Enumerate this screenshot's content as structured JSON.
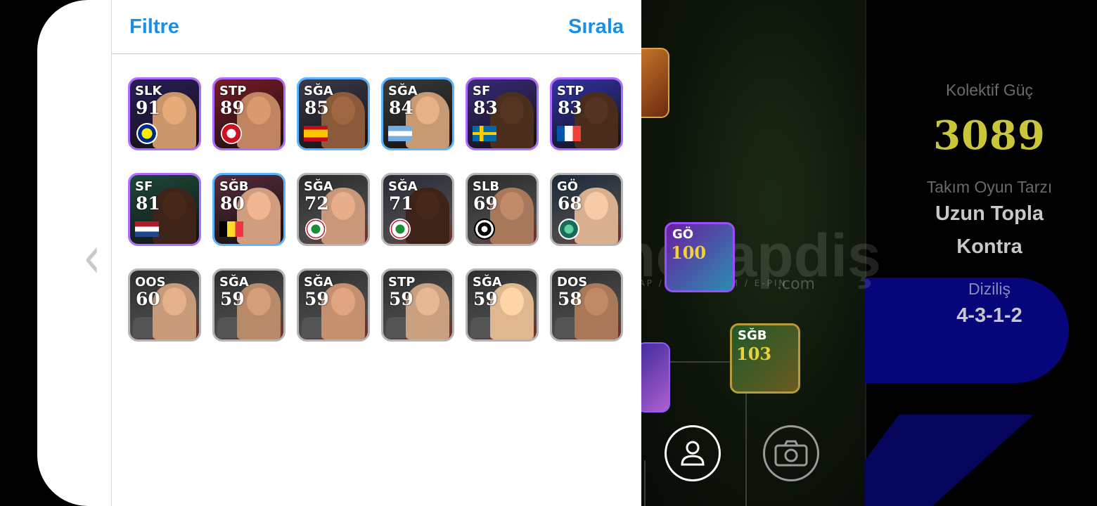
{
  "header": {
    "filter_label": "Filtre",
    "sort_label": "Sıralа"
  },
  "stats": {
    "collective_power_label": "Kolektif Güç",
    "collective_power_value": "3089",
    "playstyle_label": "Takım Oyun Tarzı",
    "playstyle_value_line1": "Uzun Topla",
    "playstyle_value_line2": "Kontra",
    "formation_label": "Diziliş",
    "formation_value": "4-3-1-2"
  },
  "field_cards": {
    "mid": {
      "pos": "GÖ",
      "ovr": "100"
    },
    "sgb": {
      "pos": "SĞB",
      "ovr": "103"
    }
  },
  "watermark": {
    "main": "hesapdiş",
    "sub": "HESAP / SKIN / ITEM / E-PIN",
    "com": ".com"
  },
  "players": [
    {
      "pos": "SLK",
      "ovr": "91",
      "emblem": "fenerbahce-badge-icon",
      "frame": "purple",
      "bg": "#2a1d5a",
      "skin": "#c9956a"
    },
    {
      "pos": "STP",
      "ovr": "89",
      "emblem": "antalyaspor-badge-icon",
      "frame": "purple",
      "bg": "#7a1a24",
      "skin": "#c08560"
    },
    {
      "pos": "SĞA",
      "ovr": "85",
      "emblem": "spain-flag-icon",
      "frame": "blue",
      "bg": "#3e3a4a",
      "skin": "#8a5a3a"
    },
    {
      "pos": "SĞA",
      "ovr": "84",
      "emblem": "argentina-flag-icon",
      "frame": "blue",
      "bg": "#3a3a3a",
      "skin": "#c79a74"
    },
    {
      "pos": "SF",
      "ovr": "83",
      "emblem": "sweden-flag-icon",
      "frame": "purple",
      "bg": "#3a2a7a",
      "skin": "#4a2e1e"
    },
    {
      "pos": "STP",
      "ovr": "83",
      "emblem": "france-flag-icon",
      "frame": "purple",
      "bg": "#3232a8",
      "skin": "#4a2c1c"
    },
    {
      "pos": "SF",
      "ovr": "81",
      "emblem": "netherlands-flag-icon",
      "frame": "purple",
      "bg": "#1d4a3a",
      "skin": "#3e2418"
    },
    {
      "pos": "SĞB",
      "ovr": "80",
      "emblem": "belgium-flag-icon",
      "frame": "blue",
      "bg": "#5a2a3a",
      "skin": "#d09e7e"
    },
    {
      "pos": "SĞA",
      "ovr": "72",
      "emblem": "rizespor-badge-icon",
      "frame": "gray",
      "bg": "#2a2a2a",
      "skin": "#c9977a"
    },
    {
      "pos": "SĞA",
      "ovr": "71",
      "emblem": "rizespor-badge-icon",
      "frame": "gray",
      "bg": "#2a2a3a",
      "skin": "#3e2418"
    },
    {
      "pos": "SLB",
      "ovr": "69",
      "emblem": "club-badge-icon",
      "frame": "gray",
      "bg": "#2a2a2a",
      "skin": "#a8785a"
    },
    {
      "pos": "GÖ",
      "ovr": "68",
      "emblem": "shonan-badge-icon",
      "frame": "gray",
      "bg": "#1a2a3a",
      "skin": "#d8b090"
    },
    {
      "pos": "OOS",
      "ovr": "60",
      "emblem": "silhouette-icon",
      "frame": "gray",
      "bg": "#2e2e2e",
      "skin": "#c79a7a"
    },
    {
      "pos": "SĞA",
      "ovr": "59",
      "emblem": "silhouette-icon",
      "frame": "gray",
      "bg": "#2e2e2e",
      "skin": "#b98a6a"
    },
    {
      "pos": "SĞA",
      "ovr": "59",
      "emblem": "silhouette-icon",
      "frame": "gray",
      "bg": "#2e2e2e",
      "skin": "#c49070"
    },
    {
      "pos": "STP",
      "ovr": "59",
      "emblem": "silhouette-icon",
      "frame": "gray",
      "bg": "#2e2e2e",
      "skin": "#c9a080"
    },
    {
      "pos": "SĞA",
      "ovr": "59",
      "emblem": "silhouette-icon",
      "frame": "gray",
      "bg": "#2e2e2e",
      "skin": "#e0b890"
    },
    {
      "pos": "DOS",
      "ovr": "58",
      "emblem": "silhouette-icon",
      "frame": "gray",
      "bg": "#2e2e2e",
      "skin": "#a87858"
    }
  ],
  "colors": {
    "accent": "#1a8fe6",
    "power": "#c9c63a",
    "purple_frame": "#b06cff",
    "blue_frame": "#5cb3ff"
  }
}
